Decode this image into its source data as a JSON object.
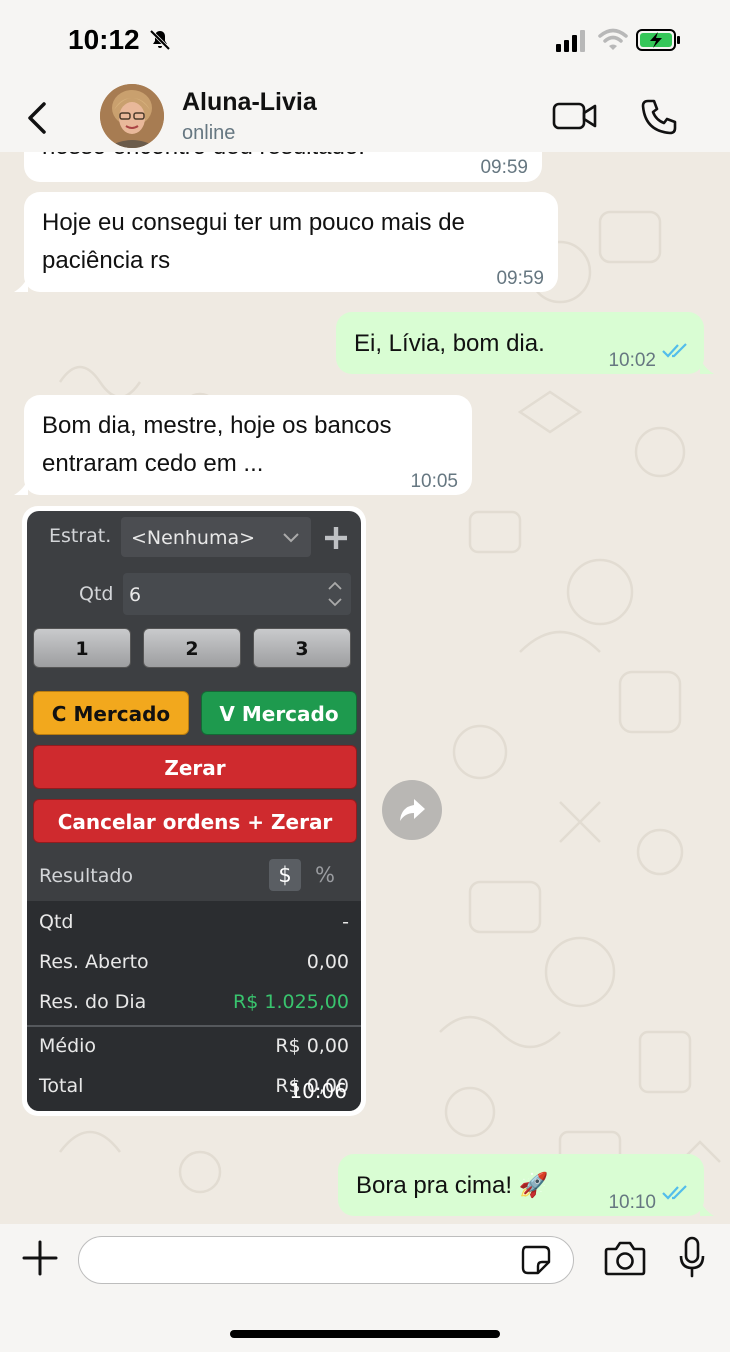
{
  "status_bar": {
    "time": "10:12"
  },
  "header": {
    "contact_name": "Aluna-Livia",
    "contact_status": "online"
  },
  "messages": [
    {
      "direction": "in",
      "text": "nosso encontro deu resultado.",
      "time": "09:59"
    },
    {
      "direction": "in",
      "text_line1": "Hoje eu consegui ter um pouco mais de",
      "text_line2": "paciência rs",
      "time": "09:59"
    },
    {
      "direction": "out",
      "text": "Ei, Lívia, bom dia.",
      "time": "10:02",
      "read": true
    },
    {
      "direction": "in",
      "text_line1": "Bom dia, mestre, hoje os bancos",
      "text_line2": "entraram cedo em ...",
      "time": "10:05"
    },
    {
      "direction": "in",
      "type": "image",
      "time": "10:06"
    },
    {
      "direction": "out",
      "text": "Bora pra cima! 🚀",
      "time": "10:10",
      "read": true
    }
  ],
  "trading_panel": {
    "strategy_label": "Estrat.",
    "strategy_value": "<Nenhuma>",
    "qty_label": "Qtd",
    "qty_value": "6",
    "quick_buttons": [
      "1",
      "2",
      "3"
    ],
    "buy_market": "C Mercado",
    "sell_market": "V Mercado",
    "zero": "Zerar",
    "cancel_zero": "Cancelar ordens + Zerar",
    "result_label": "Resultado",
    "currency_toggle": "$",
    "percent_toggle": "%",
    "rows": [
      {
        "label": "Qtd",
        "value": "-"
      },
      {
        "label": "Res. Aberto",
        "value": "0,00"
      },
      {
        "label": "Res. do Dia",
        "value": "R$ 1.025,00"
      },
      {
        "label": "Médio",
        "value": "R$ 0,00"
      },
      {
        "label": "Total",
        "value": "R$ 0,00"
      }
    ],
    "colors": {
      "buy": "#f2a81d",
      "sell": "#1e9a4e",
      "zero": "#cf2a2e",
      "positive": "#39c46e"
    }
  },
  "input_bar": {
    "placeholder": ""
  },
  "colors": {
    "incoming": "#ffffff",
    "outgoing": "#d9fdd3",
    "read_tick": "#53bdeb",
    "timestamp": "#667781"
  }
}
